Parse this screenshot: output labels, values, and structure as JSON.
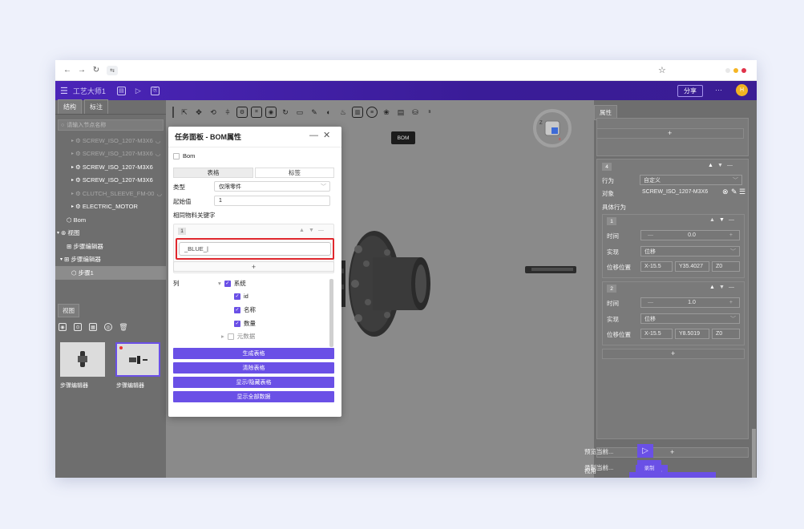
{
  "browser": {
    "back": "←",
    "forward": "→",
    "reload": "↻",
    "site_icon": "⇆",
    "star": "☆",
    "window_dots": [
      "#e8e8e8",
      "#f5b524",
      "#e0334a"
    ]
  },
  "header": {
    "menu_icon": "☰",
    "title": "工艺大师1",
    "share_label": "分享",
    "more_label": "···",
    "avatar_initial": "H"
  },
  "left_panel": {
    "tabs": [
      "结构",
      "标注"
    ],
    "search_placeholder": "请输入节点名称",
    "tree": [
      {
        "label": "SCREW_ISO_1207-M3X6",
        "dim": true
      },
      {
        "label": "SCREW_ISO_1207-M3X6",
        "dim": true
      },
      {
        "label": "SCREW_ISO_1207-M3X6",
        "dim": false
      },
      {
        "label": "SCREW_ISO_1207-M3X6",
        "dim": false
      },
      {
        "label": "CLUTCH_SLEEVE_FM-00",
        "dim": true
      },
      {
        "label": "ELECTRIC_MOTOR",
        "dim": false
      },
      {
        "label": "Bom",
        "dim": false
      },
      {
        "label": "视图",
        "dim": false
      },
      {
        "label": "步骤编辑器",
        "dim": false
      },
      {
        "label": "步骤编辑器",
        "dim": false
      },
      {
        "label": "步骤1",
        "dim": false
      }
    ],
    "view_tab": "视图",
    "thumbnail_labels": [
      "步骤编辑器",
      "步骤编辑器"
    ]
  },
  "viewport": {
    "tooltip": "BOM"
  },
  "dialog": {
    "title": "任务面板 - BOM属性",
    "bom_checkbox": "Bom",
    "tab_table": "表格",
    "tab_label": "标签",
    "type_label": "类型",
    "type_value": "仅限零件",
    "start_label": "起始值",
    "start_value": "1",
    "keywords_label": "相同物料关键字",
    "item_index": "1",
    "keyword_value": "_BLUE_",
    "add_symbol": "+",
    "columns_label": "列",
    "columns": {
      "system": "系统",
      "id": "id",
      "name": "名称",
      "quantity": "数量",
      "metadata": "元数据"
    },
    "buttons": [
      "生成表格",
      "清除表格",
      "显示/隐藏表格",
      "显示全部数据"
    ]
  },
  "right_panel": {
    "tab": "属性",
    "block4_index": "4",
    "behavior_label": "行为",
    "behavior_value": "自定义",
    "target_label": "对象",
    "target_value": "SCREW_ISO_1207-M3X6",
    "specific_label": "具体行为",
    "steps": [
      {
        "index": "1",
        "time_label": "时间",
        "time": "0.0",
        "impl_label": "实现",
        "impl": "位移",
        "pos_label": "位移位置",
        "x": "X-15.5",
        "y": "Y35.4027",
        "z": "Z0"
      },
      {
        "index": "2",
        "time_label": "时间",
        "time": "1.0",
        "impl_label": "实现",
        "impl": "位移",
        "pos_label": "位移位置",
        "x": "X-15.5",
        "y": "Y8.5019",
        "z": "Z0"
      }
    ],
    "view_label": "视角",
    "update_view_btn": "更新视角",
    "preview_label": "预览当前...",
    "record_label": "录制当前...",
    "record_btn": "录制"
  }
}
